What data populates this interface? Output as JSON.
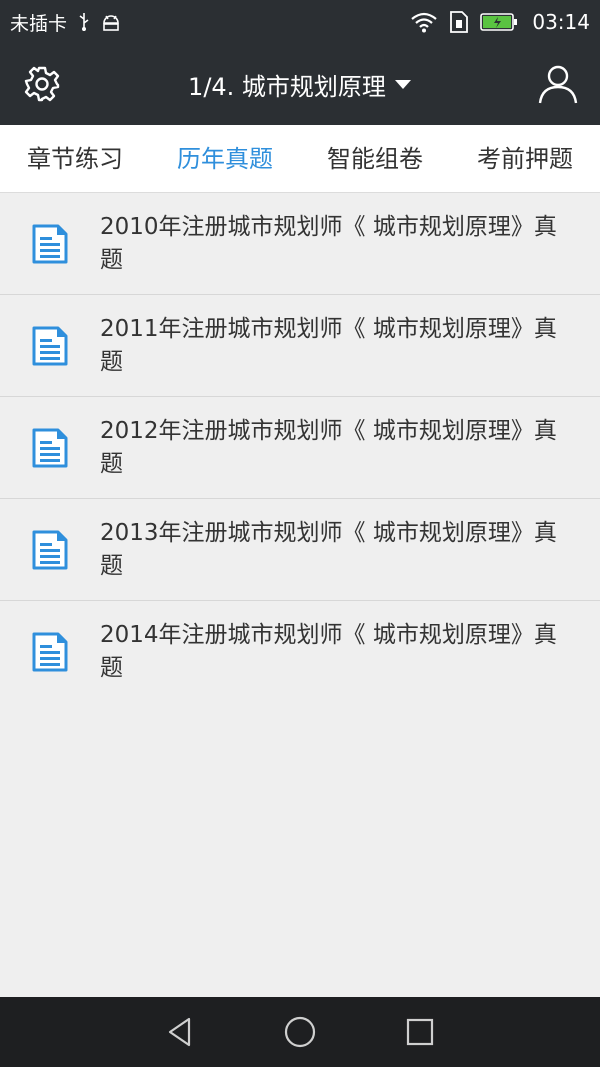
{
  "status_bar": {
    "carrier": "未插卡",
    "time": "03:14",
    "icons": [
      "usb-icon",
      "android-debug-icon",
      "wifi-icon",
      "sim-icon",
      "battery-icon"
    ]
  },
  "header": {
    "title": "1/4. 城市规划原理",
    "icons": [
      "gear-icon",
      "chevron-down-icon",
      "user-icon"
    ]
  },
  "tabs": [
    {
      "label": "章节练习",
      "active": false
    },
    {
      "label": "历年真题",
      "active": true
    },
    {
      "label": "智能组卷",
      "active": false
    },
    {
      "label": "考前押题",
      "active": false
    }
  ],
  "list": {
    "items": [
      {
        "title": "2010年注册城市规划师《 城市规划原理》真题"
      },
      {
        "title": "2011年注册城市规划师《 城市规划原理》真题"
      },
      {
        "title": "2012年注册城市规划师《 城市规划原理》真题"
      },
      {
        "title": "2013年注册城市规划师《 城市规划原理》真题"
      },
      {
        "title": "2014年注册城市规划师《 城市规划原理》真题"
      }
    ]
  },
  "colors": {
    "header_bg": "#2b2f33",
    "accent": "#2f8fdc",
    "battery": "#5ac341",
    "list_bg": "#efefef"
  },
  "nav_bar": {
    "icons": [
      "back-icon",
      "home-icon",
      "recents-icon"
    ]
  }
}
